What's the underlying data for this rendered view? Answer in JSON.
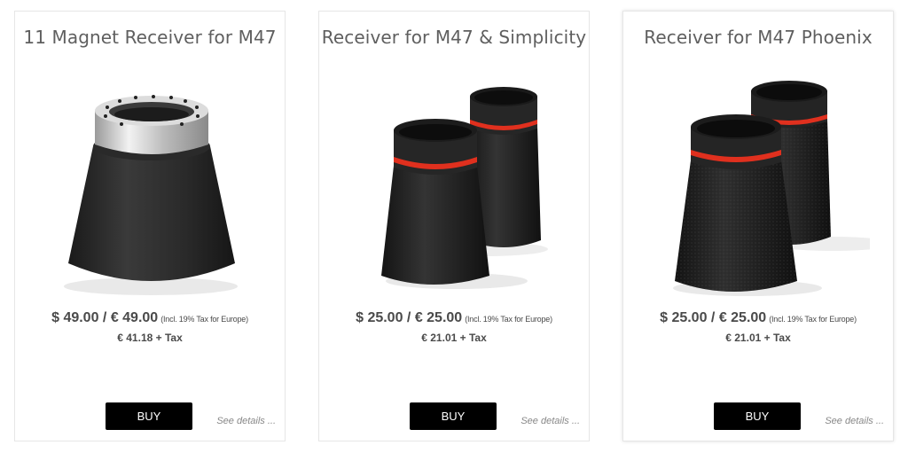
{
  "products": [
    {
      "title": "11 Magnet Receiver for M47",
      "price": "$ 49.00 / € 49.00",
      "tax_note": "(Incl. 19% Tax for Europe)",
      "net_price": "€ 41.18 + Tax",
      "buy_label": "BUY",
      "details_label": "See details ..."
    },
    {
      "title": "Receiver for M47 & Simplicity",
      "price": "$ 25.00 / € 25.00",
      "tax_note": "(Incl. 19% Tax for Europe)",
      "net_price": "€ 21.01 + Tax",
      "buy_label": "BUY",
      "details_label": "See details ..."
    },
    {
      "title": "Receiver for M47 Phoenix",
      "price": "$ 25.00 / € 25.00",
      "tax_note": "(Incl. 19% Tax for Europe)",
      "net_price": "€ 21.01 + Tax",
      "buy_label": "BUY",
      "details_label": "See details ..."
    }
  ],
  "colors": {
    "button": "#000000",
    "receiver_body": "#2b2b2b",
    "steel_ring": "#c8c8c8",
    "red_ring": "#e0301e"
  }
}
